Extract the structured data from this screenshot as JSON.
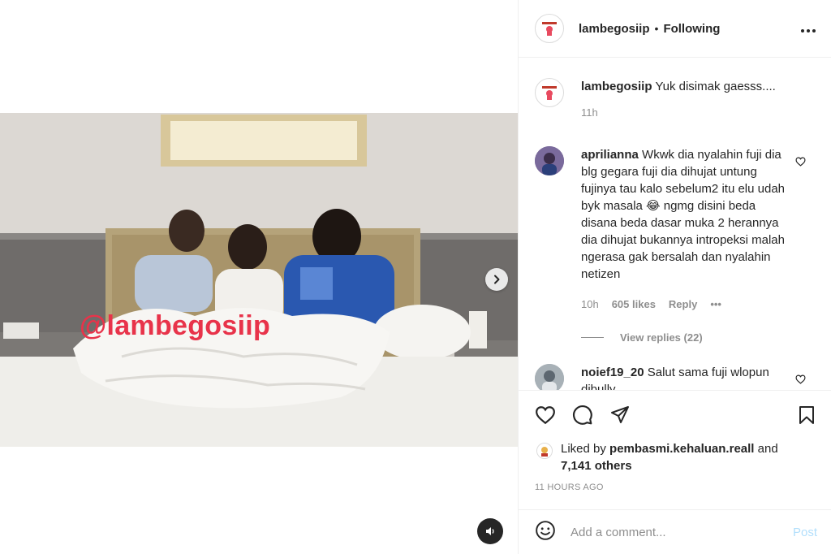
{
  "post": {
    "watermark": "@lambegosiip",
    "next_icon": "chevron-right-icon",
    "audio_icon": "speaker-icon"
  },
  "header": {
    "username": "lambegosiip",
    "separator": "•",
    "follow_status": "Following",
    "more_icon": "more-horizontal-icon"
  },
  "caption": {
    "username": "lambegosiip",
    "text": "Yuk disimak gaesss....",
    "time": "11h"
  },
  "comments": [
    {
      "username": "aprilianna",
      "text": "Wkwk dia nyalahin fuji dia blg gegara fuji dia dihujat untung fujinya tau kalo sebelum2 itu elu udah byk masala 😂 ngmg disini beda disana beda dasar muka 2 herannya dia dihujat bukannya intropeksi malah ngerasa gak bersalah dan nyalahin netizen",
      "time": "10h",
      "likes": "605 likes",
      "reply_label": "Reply",
      "more": "•••",
      "view_replies": "View replies (22)"
    },
    {
      "username": "noief19_20",
      "text": "Salut sama fuji wlopun dibully..."
    }
  ],
  "actions": {
    "like_icon": "heart-icon",
    "comment_icon": "comment-icon",
    "share_icon": "share-icon",
    "save_icon": "bookmark-icon"
  },
  "likes": {
    "prefix": "Liked by ",
    "user": "pembasmi.kehaluan.reall",
    "connector": " and",
    "others": "7,141 others"
  },
  "time_ago": "11 HOURS AGO",
  "add_comment": {
    "placeholder": "Add a comment...",
    "post_label": "Post",
    "emoji_icon": "emoji-icon"
  }
}
